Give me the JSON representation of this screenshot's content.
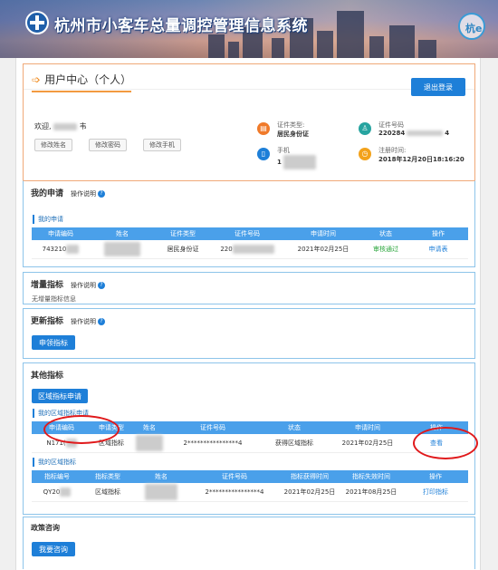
{
  "header": {
    "system_title": "杭州市小客车总量调控管理信息系统",
    "mascot_text": "杭e"
  },
  "user_center": {
    "title": "用户中心（个人）",
    "logout_label": "退出登录",
    "welcome_prefix": "欢迎,",
    "welcome_suffix": "韦",
    "buttons": [
      "修改姓名",
      "修改密码",
      "修改手机"
    ],
    "id_type_label": "证件类型:",
    "id_type_value": "居民身份证",
    "phone_label": "手机",
    "phone_value": "1",
    "id_number_label": "证件号码",
    "id_number_prefix": "220284",
    "id_number_suffix": "4",
    "register_label": "注册时间:",
    "register_value": "2018年12月20日18:16:20"
  },
  "my_application": {
    "title": "我的申请",
    "help": "操作说明",
    "sub_title": "我的申请",
    "columns": [
      "申请编码",
      "姓名",
      "证件类型",
      "证件号码",
      "申请时间",
      "状态",
      "操作"
    ],
    "row": {
      "code": "743210",
      "id_type": "居民身份证",
      "id_number": "220",
      "time": "2021年02月25日",
      "status": "审核通过",
      "action": "申请表"
    }
  },
  "increment": {
    "title": "增量指标",
    "help": "操作说明",
    "empty_text": "无增量指标信息"
  },
  "renewal": {
    "title": "更新指标",
    "help": "操作说明",
    "button": "申领指标"
  },
  "other": {
    "title": "其他指标",
    "button": "区域指标申请",
    "apply_sub_title": "我的区域指标申请",
    "apply_columns": [
      "申请编码",
      "申请类型",
      "姓名",
      "证件号码",
      "状态",
      "申请时间",
      "操作"
    ],
    "apply_row": {
      "code": "N171(",
      "type": "区域指标",
      "id_number": "2****************4",
      "status": "获得区域指标",
      "time": "2021年02月25日",
      "action": "查看"
    },
    "quota_sub_title": "我的区域指标",
    "quota_columns": [
      "指标编号",
      "指标类型",
      "姓名",
      "证件号码",
      "指标获得时间",
      "指标失效时间",
      "操作"
    ],
    "quota_row": {
      "code": "QY20",
      "type": "区域指标",
      "id_number": "2****************4",
      "obtain_time": "2021年02月25日",
      "expire_time": "2021年08月25日",
      "action": "打印指标"
    }
  },
  "policy": {
    "title": "政策咨询",
    "button": "我要咨询"
  },
  "colors": {
    "primary": "#1e7fd8",
    "table_header": "#4aa0ea",
    "accent_orange": "#f39a40",
    "success": "#2aa63c",
    "highlight_red": "#e0191b"
  }
}
